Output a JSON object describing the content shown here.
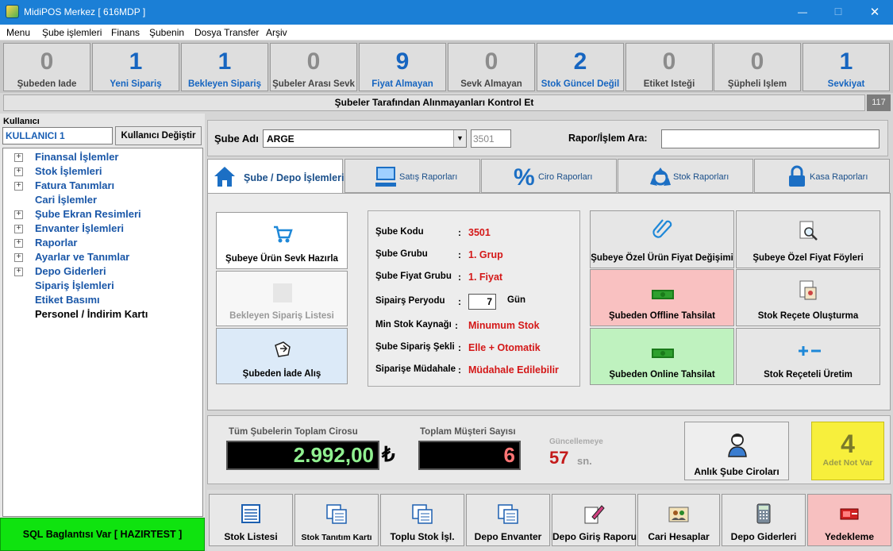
{
  "window": {
    "title": "MidiPOS Merkez [ 616MDP  ]",
    "minimize": "—",
    "maximize": "☐",
    "close": "✕"
  },
  "menu": [
    "Menu",
    "Şube işlemleri",
    "Finans",
    "Şubenin",
    "Dosya Transfer",
    "Arşiv"
  ],
  "stats": [
    {
      "value": "0",
      "label": "Şubeden İade"
    },
    {
      "value": "1",
      "label": "Yeni Sipariş"
    },
    {
      "value": "1",
      "label": "Bekleyen Sipariş"
    },
    {
      "value": "0",
      "label": "Şubeler Arası Sevk"
    },
    {
      "value": "9",
      "label": "Fiyat Almayan"
    },
    {
      "value": "0",
      "label": "Sevk Almayan"
    },
    {
      "value": "2",
      "label": "Stok Güncel Değil"
    },
    {
      "value": "0",
      "label": "Etiket İsteği"
    },
    {
      "value": "0",
      "label": "Şüpheli İşlem"
    },
    {
      "value": "1",
      "label": "Sevkiyat"
    }
  ],
  "control_bar": {
    "text": "Şubeler Tarafından Alınmayanları Kontrol Et",
    "count": "117"
  },
  "user": {
    "label": "Kullanıcı",
    "value": "KULLANICI 1",
    "change_button": "Kullanıcı Değiştir"
  },
  "tree": [
    "Finansal İşlemler",
    "Stok İşlemleri",
    "Fatura Tanımları",
    "Cari İşlemler",
    "Şube Ekran Resimleri",
    "Envanter İşlemleri",
    "Raporlar",
    "Ayarlar ve Tanımlar",
    "Depo Giderleri",
    "Sipariş İşlemleri",
    "Etiket Basımı",
    "Personel / İndirim Kartı"
  ],
  "sql_status": "SQL Baglantısı Var [ HAZIRTEST ]",
  "sube": {
    "label": "Şube Adı",
    "selected": "ARGE",
    "code": "3501",
    "search_label": "Rapor/İşlem Ara:",
    "search_value": ""
  },
  "tabs": [
    "Şube / Depo İşlemleri",
    "Satış Raporları",
    "Ciro Raporları",
    "Stok Raporları",
    "Kasa Raporları"
  ],
  "actions_left": [
    "Şubeye Ürün Sevk Hazırla",
    "Bekleyen Sipariş Listesi",
    "Şubeden İade Alış"
  ],
  "info": [
    {
      "key": "Şube Kodu",
      "value": "3501"
    },
    {
      "key": "Şube Grubu",
      "value": "1. Grup"
    },
    {
      "key": "Şube Fiyat Grubu",
      "value": "1. Fiyat"
    },
    {
      "key": "Sipairş Peryodu",
      "value": "7",
      "unit": "Gün"
    },
    {
      "key": "Min Stok Kaynağı",
      "value": "Minumum Stok"
    },
    {
      "key": "Şube Sipariş Şekli",
      "value": "Elle + Otomatik"
    },
    {
      "key": "Siparişe Müdahale",
      "value": "Müdahale Edilebilir"
    }
  ],
  "actions_right": [
    "Şubeye Özel Ürün Fiyat Değişimi",
    "Şubeye Özel Fiyat Föyleri",
    "Şubeden Offline Tahsilat",
    "Stok Reçete Oluşturma",
    "Şubeden Online Tahsilat",
    "Stok Reçeteli Üretim"
  ],
  "summary": {
    "ciro_label": "Tüm Şubelerin Toplam Cirosu",
    "ciro_value": "2.992,00",
    "currency": "₺",
    "musteri_label": "Toplam Müşteri Sayısı",
    "musteri_value": "6",
    "update_label": "Güncellemeye",
    "update_value": "57",
    "update_unit": "sn.",
    "anlik_button": "Anlık Şube Ciroları",
    "note_count": "4",
    "note_label": "Adet Not Var"
  },
  "toolbar": [
    "Stok Listesi",
    "Stok Tanıtım Kartı",
    "Toplu Stok İşl.",
    "Depo Envanter",
    "Depo Giriş Raporu",
    "Cari  Hesaplar",
    "Depo Giderleri",
    "Yedekleme"
  ],
  "colors": {
    "titlebar": "#1b7fd6",
    "blue_text": "#1665c0",
    "red_value": "#d41818",
    "sql_green": "#0fe30f",
    "offline_pink": "#f9c1c1",
    "online_green": "#bff2bf",
    "iade_blue": "#dceaf8",
    "note_yellow": "#f7ef3c",
    "ciro_green": "#90f090",
    "musteri_red": "#ff7575"
  }
}
